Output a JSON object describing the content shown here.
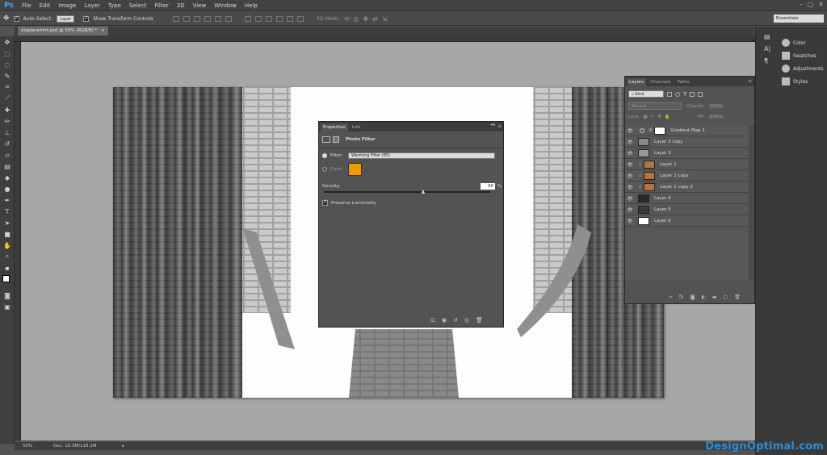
{
  "app": {
    "logo": "Ps"
  },
  "menu": [
    "File",
    "Edit",
    "Image",
    "Layer",
    "Type",
    "Select",
    "Filter",
    "3D",
    "View",
    "Window",
    "Help"
  ],
  "window_controls": [
    "–",
    "▢",
    "✕"
  ],
  "options": {
    "auto_select_label": "Auto-Select:",
    "auto_select_value": "Layer",
    "transform_label": "Show Transform Controls",
    "mode3d": "3D Mode:"
  },
  "workspace": "Essentials",
  "document": {
    "tab_title": "displacemnt.psd @ 50% (RGB/8) *",
    "close": "×",
    "zoom": "50%",
    "doc_size": "Doc: 10.3M/118.1M"
  },
  "dock": {
    "items": [
      "Color",
      "Swatches",
      "Adjustments",
      "Styles"
    ]
  },
  "layers_panel": {
    "tabs": [
      "Layers",
      "Channels",
      "Paths"
    ],
    "kind": "Kind",
    "blend": "Normal",
    "opacity_label": "Opacity:",
    "opacity": "100%",
    "lock_label": "Lock:",
    "fill_label": "Fill:",
    "fill": "100%",
    "layers": [
      {
        "name": "Gradient Map 1"
      },
      {
        "name": "Layer 3 copy"
      },
      {
        "name": "Layer 3"
      },
      {
        "name": "Layer 1"
      },
      {
        "name": "Layer 1 copy"
      },
      {
        "name": "Layer 1 copy 2"
      },
      {
        "name": "Layer 4"
      },
      {
        "name": "Layer 5"
      },
      {
        "name": "Layer 0"
      }
    ]
  },
  "properties_panel": {
    "tabs": [
      "Properties",
      "Info"
    ],
    "title": "Photo Filter",
    "filter_label": "Filter:",
    "filter_value": "Warming Filter (85)",
    "color_label": "Color:",
    "color_hex": "#ee9b00",
    "density_label": "Density:",
    "density_value": "60",
    "density_unit": "%",
    "density_fraction": 0.6,
    "preserve_label": "Preserve Luminosity"
  },
  "watermark": "DesignOptimal.com"
}
